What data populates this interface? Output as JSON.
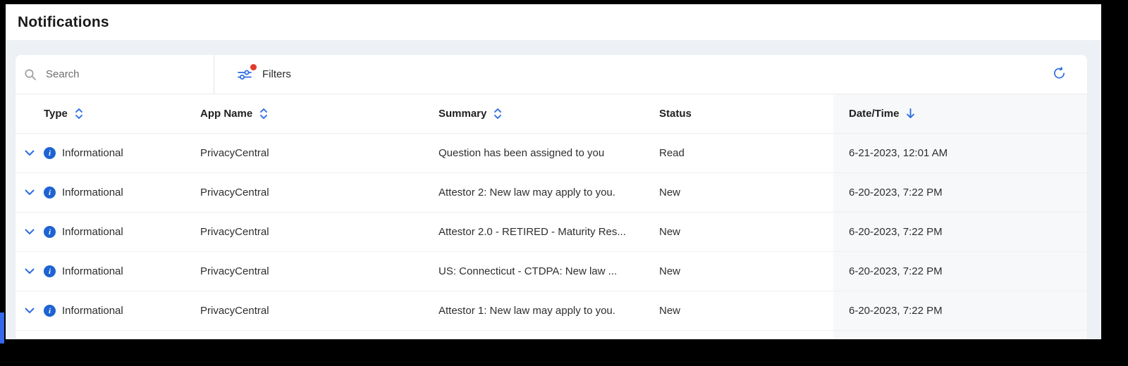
{
  "page": {
    "title": "Notifications"
  },
  "toolbar": {
    "search_placeholder": "Search",
    "filters_label": "Filters"
  },
  "icons": {
    "search": "search-icon",
    "filters": "sliders-icon",
    "filters_badge": "red-dot-badge",
    "refresh": "refresh-icon",
    "sort": "sort-up-down-icon",
    "sorted_desc": "arrow-down-icon",
    "row_expand": "chevron-down-icon",
    "row_type": "info-icon"
  },
  "colors": {
    "accent_blue": "#2b6ce2",
    "info_blue": "#1e63d3",
    "badge_red": "#e23a2a",
    "page_bg": "#edf1f6",
    "sorted_col_bg": "#f7f8fa",
    "title_text": "#1a1a1a",
    "body_text": "#2e2e2e",
    "edge_accent_blue": "#3568e8"
  },
  "table": {
    "columns": [
      {
        "key": "type",
        "label": "Type",
        "sortable": true,
        "sorted": null
      },
      {
        "key": "app",
        "label": "App Name",
        "sortable": true,
        "sorted": null
      },
      {
        "key": "summary",
        "label": "Summary",
        "sortable": true,
        "sorted": null
      },
      {
        "key": "status",
        "label": "Status",
        "sortable": false,
        "sorted": null
      },
      {
        "key": "datetime",
        "label": "Date/Time",
        "sortable": true,
        "sorted": "desc"
      }
    ],
    "rows": [
      {
        "type": "Informational",
        "app": "PrivacyCentral",
        "summary": "Question has been assigned to you",
        "status": "Read",
        "datetime": "6-21-2023, 12:01 AM"
      },
      {
        "type": "Informational",
        "app": "PrivacyCentral",
        "summary": "Attestor 2: New law may apply to you.",
        "status": "New",
        "datetime": "6-20-2023, 7:22 PM"
      },
      {
        "type": "Informational",
        "app": "PrivacyCentral",
        "summary": "Attestor 2.0 - RETIRED - Maturity Res...",
        "status": "New",
        "datetime": "6-20-2023, 7:22 PM"
      },
      {
        "type": "Informational",
        "app": "PrivacyCentral",
        "summary": "US: Connecticut - CTDPA: New law ...",
        "status": "New",
        "datetime": "6-20-2023, 7:22 PM"
      },
      {
        "type": "Informational",
        "app": "PrivacyCentral",
        "summary": "Attestor 1: New law may apply to you.",
        "status": "New",
        "datetime": "6-20-2023, 7:22 PM"
      }
    ]
  }
}
